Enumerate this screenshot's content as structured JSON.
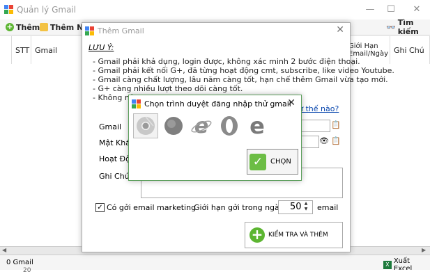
{
  "app": {
    "title": "Quản lý Gmail",
    "window_controls": [
      "—",
      "☐",
      "✕"
    ]
  },
  "toolbar": {
    "add_label": "Thêm",
    "add_n_label": "Thêm Nh",
    "search_label": "Tìm kiếm"
  },
  "grid": {
    "columns": [
      "STT",
      "Gmail",
      "Giới Hạn\nEmail/Ngày",
      "Ghi Chú"
    ]
  },
  "status": {
    "count_label": "0 Gmail",
    "export_label": "Xuất Excel",
    "row_hint": "20"
  },
  "dialog": {
    "title": "Thêm Gmail",
    "note_heading": "LƯU Ý:",
    "notes": [
      "- Gmail phải khả dụng, login được, không xác minh 2 bước điện thoại.",
      "- Gmail phải kết nối G+, đã từng hoạt động cmt, subscribe, like video Youtube.",
      "- Gmail càng chất lượng, lâu năm càng tốt, hạn chế thêm Gmail vừa tạo mới.",
      "- G+ càng nhiều lượt theo dõi càng tốt.",
      "- Không nê"
    ],
    "howto_link": "ư thế nào?",
    "fields": {
      "gmail_label": "Gmail",
      "password_label": "Mật Khẩ",
      "activity_label": "Hoạt Độn",
      "note_label": "Ghi Chú"
    },
    "marketing_checked": true,
    "marketing_label": "Có gởi email marketing",
    "limit_label": "Giới hạn gởi trong ngày",
    "limit_value": "50",
    "limit_unit": "email",
    "check_add_label": "KIỂM TRA VÀ THÊM"
  },
  "chooser": {
    "title": "Chọn trình duyệt đăng nhập thử gmail",
    "browsers": [
      "chrome-icon",
      "firefox-icon",
      "edge-icon",
      "opera-icon",
      "ie-icon"
    ],
    "choose_label": "CHỌN"
  },
  "colors": {
    "accent_green": "#5cb531",
    "link_blue": "#0645ad",
    "chooser_border": "#5a9e5a"
  }
}
